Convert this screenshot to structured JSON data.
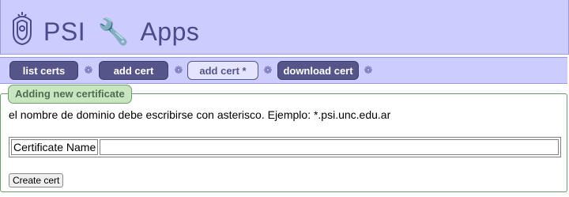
{
  "header": {
    "title_left": "PSI",
    "wrench_glyph": "🔧",
    "title_right": "Apps",
    "logo_icon": "university-seal-icon"
  },
  "nav": {
    "tabs": [
      {
        "label": "list certs",
        "state": "inactive"
      },
      {
        "label": "add cert",
        "state": "inactive"
      },
      {
        "label": "add cert *",
        "state": "active"
      },
      {
        "label": "download cert",
        "state": "inactive"
      }
    ],
    "separator_glyph": "❁"
  },
  "section": {
    "legend": "Adding new certificate",
    "note": "el nombre de dominio debe escribirse con asterisco. Ejemplo: *.psi.unc.edu.ar"
  },
  "form": {
    "cert_name_label": "Certificate Name",
    "cert_name_value": "",
    "cert_name_placeholder": "",
    "submit_label": "Create cert"
  },
  "colors": {
    "header_bg": "#ccccff",
    "tab_dark": "#55558a",
    "tab_active_bg": "#e4e4ff",
    "legend_bg": "#c8e6c0"
  }
}
